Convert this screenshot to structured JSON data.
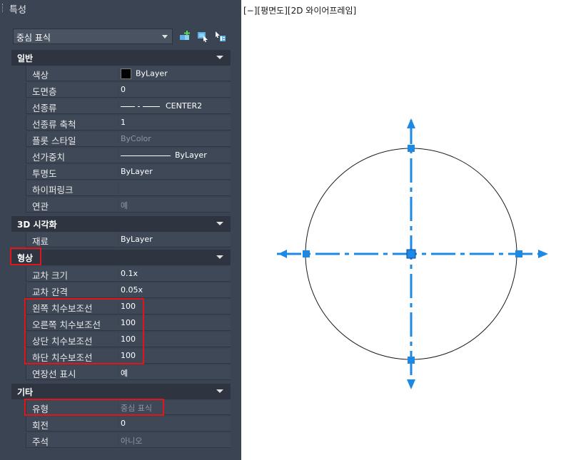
{
  "panel": {
    "title": "특성",
    "object_select": "중심 표식"
  },
  "categories": {
    "general": "일반",
    "viz3d": "3D 시각화",
    "geometry": "형상",
    "misc": "기타"
  },
  "general": {
    "color_k": "색상",
    "color_v": "ByLayer",
    "layer_k": "도면층",
    "layer_v": "0",
    "linetype_k": "선종류",
    "linetype_v": "CENTER2",
    "ltscale_k": "선종류 축척",
    "ltscale_v": "1",
    "plotstyle_k": "플롯 스타일",
    "plotstyle_v": "ByColor",
    "lineweight_k": "선가중치",
    "lineweight_v": "ByLayer",
    "transparency_k": "투명도",
    "transparency_v": "ByLayer",
    "hyperlink_k": "하이퍼링크",
    "hyperlink_v": "",
    "assoc_k": "연관",
    "assoc_v": "예"
  },
  "viz3d": {
    "material_k": "재료",
    "material_v": "ByLayer"
  },
  "geometry": {
    "cross_size_k": "교차 크기",
    "cross_size_v": "0.1x",
    "cross_gap_k": "교차 간격",
    "cross_gap_v": "0.05x",
    "left_ext_k": "왼쪽 치수보조선",
    "left_ext_v": "100",
    "right_ext_k": "오른쪽 치수보조선",
    "right_ext_v": "100",
    "top_ext_k": "상단 치수보조선",
    "top_ext_v": "100",
    "bottom_ext_k": "하단 치수보조선",
    "bottom_ext_v": "100",
    "show_ext_k": "연장선 표시",
    "show_ext_v": "예"
  },
  "misc": {
    "type_k": "유형",
    "type_v": "중심 표식",
    "rotation_k": "회전",
    "rotation_v": "0",
    "annot_k": "주석",
    "annot_v": "아니오"
  },
  "viewport": {
    "label": "[−][평면도][2D 와이어프레임]"
  },
  "colors": {
    "panel_bg": "#3b4453",
    "highlight": "#e0161b",
    "grip_blue": "#1e88e5"
  }
}
